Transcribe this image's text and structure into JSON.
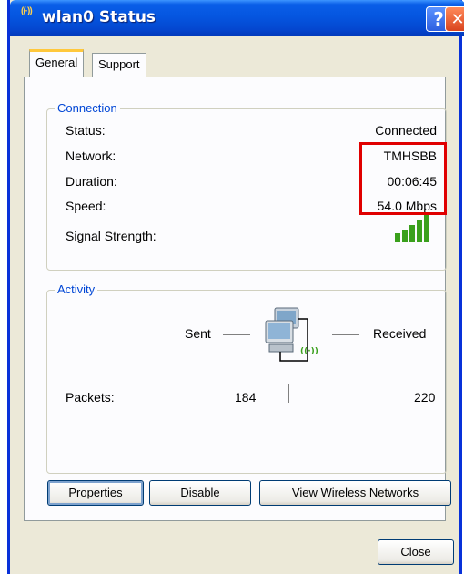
{
  "window": {
    "title": "wlan0 Status"
  },
  "tabs": [
    "General",
    "Support"
  ],
  "connection": {
    "group_label": "Connection",
    "rows": [
      {
        "label": "Status:",
        "value": "Connected"
      },
      {
        "label": "Network:",
        "value": "TMHSBB"
      },
      {
        "label": "Duration:",
        "value": "00:06:45"
      },
      {
        "label": "Speed:",
        "value": "54.0 Mbps"
      }
    ],
    "signal_label": "Signal Strength:",
    "signal_bars_lit": 5,
    "signal_bars_total": 5
  },
  "activity": {
    "group_label": "Activity",
    "sent_label": "Sent",
    "received_label": "Received",
    "packets_label": "Packets:",
    "packets_sent": "184",
    "packets_received": "220"
  },
  "buttons": {
    "properties": "Properties",
    "disable": "Disable",
    "view_networks": "View Wireless Networks",
    "close": "Close"
  },
  "colors": {
    "titlebar": "#0556e0",
    "group_label": "#0046d5",
    "highlight": "#e00000",
    "signal": "#3aa01c"
  },
  "icons": {
    "title_icon": "wireless-signal-icon",
    "activity_icon": "network-computers-icon"
  }
}
